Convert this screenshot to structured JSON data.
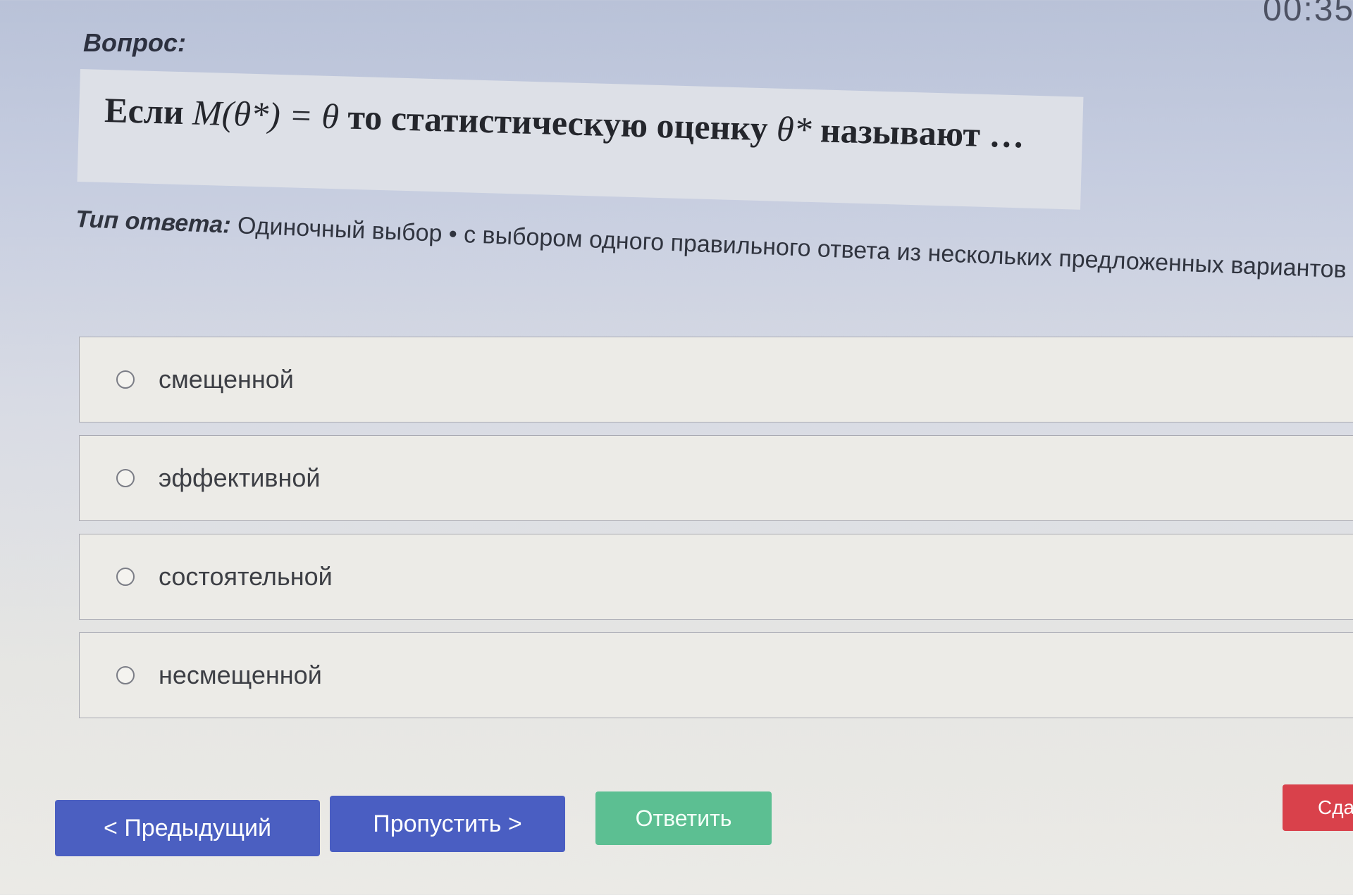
{
  "timer": "00:35",
  "question": {
    "label": "Вопрос:",
    "text_prefix": "Если",
    "formula": "M(θ*) = θ",
    "text_middle": "то статистическую оценку",
    "estimator": "θ*",
    "text_suffix": "называют …"
  },
  "answer_type": {
    "label": "Тип ответа:",
    "value": "Одиночный выбор • с выбором одного правильного ответа из нескольких предложенных вариантов"
  },
  "options": [
    {
      "label": "смещенной",
      "selected": false
    },
    {
      "label": "эффективной",
      "selected": false
    },
    {
      "label": "состоятельной",
      "selected": false
    },
    {
      "label": "несмещенной",
      "selected": false
    }
  ],
  "buttons": {
    "previous": "< Предыдущий",
    "skip": "Пропустить >",
    "answer": "Ответить",
    "submit": "Сдать"
  },
  "colors": {
    "primary": "#4b5fc1",
    "answer": "#5cbf92",
    "submit": "#d9414b"
  }
}
